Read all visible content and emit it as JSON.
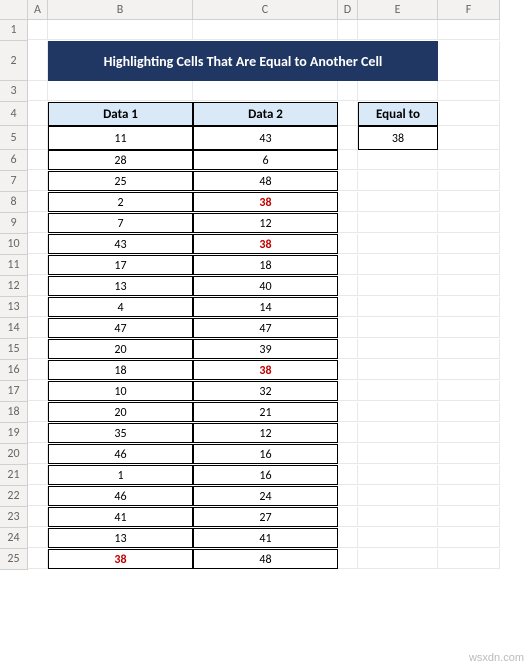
{
  "columns": [
    "A",
    "B",
    "C",
    "D",
    "E",
    "F"
  ],
  "rows": [
    "1",
    "2",
    "3",
    "4",
    "5",
    "6",
    "7",
    "8",
    "9",
    "10",
    "11",
    "12",
    "13",
    "14",
    "15",
    "16",
    "17",
    "18",
    "19",
    "20",
    "21",
    "22",
    "23",
    "24",
    "25"
  ],
  "title": "Highlighting Cells That Are Equal to Another Cell",
  "headers": {
    "data1": "Data 1",
    "data2": "Data 2",
    "equal": "Equal to"
  },
  "equal_value": "38",
  "data": [
    {
      "d1": "11",
      "d2": "43"
    },
    {
      "d1": "28",
      "d2": "6"
    },
    {
      "d1": "25",
      "d2": "48"
    },
    {
      "d1": "2",
      "d2": "38",
      "hl2": true
    },
    {
      "d1": "7",
      "d2": "12"
    },
    {
      "d1": "43",
      "d2": "38",
      "hl2": true
    },
    {
      "d1": "17",
      "d2": "18"
    },
    {
      "d1": "13",
      "d2": "40"
    },
    {
      "d1": "4",
      "d2": "14"
    },
    {
      "d1": "47",
      "d2": "47"
    },
    {
      "d1": "20",
      "d2": "39"
    },
    {
      "d1": "18",
      "d2": "38",
      "hl2": true
    },
    {
      "d1": "10",
      "d2": "32"
    },
    {
      "d1": "20",
      "d2": "21"
    },
    {
      "d1": "35",
      "d2": "12"
    },
    {
      "d1": "46",
      "d2": "16"
    },
    {
      "d1": "1",
      "d2": "16"
    },
    {
      "d1": "46",
      "d2": "24"
    },
    {
      "d1": "41",
      "d2": "27"
    },
    {
      "d1": "13",
      "d2": "41"
    },
    {
      "d1": "38",
      "d2": "48",
      "hl1": true
    }
  ],
  "watermark": "wsxdn.com",
  "chart_data": {
    "type": "table",
    "title": "Highlighting Cells That Are Equal to Another Cell",
    "columns": [
      "Data 1",
      "Data 2"
    ],
    "rows": [
      [
        11,
        43
      ],
      [
        28,
        6
      ],
      [
        25,
        48
      ],
      [
        2,
        38
      ],
      [
        7,
        12
      ],
      [
        43,
        38
      ],
      [
        17,
        18
      ],
      [
        13,
        40
      ],
      [
        4,
        14
      ],
      [
        47,
        47
      ],
      [
        20,
        39
      ],
      [
        18,
        38
      ],
      [
        10,
        32
      ],
      [
        20,
        21
      ],
      [
        35,
        12
      ],
      [
        46,
        16
      ],
      [
        1,
        16
      ],
      [
        46,
        24
      ],
      [
        41,
        27
      ],
      [
        13,
        41
      ],
      [
        38,
        48
      ]
    ],
    "highlight_value": 38
  }
}
